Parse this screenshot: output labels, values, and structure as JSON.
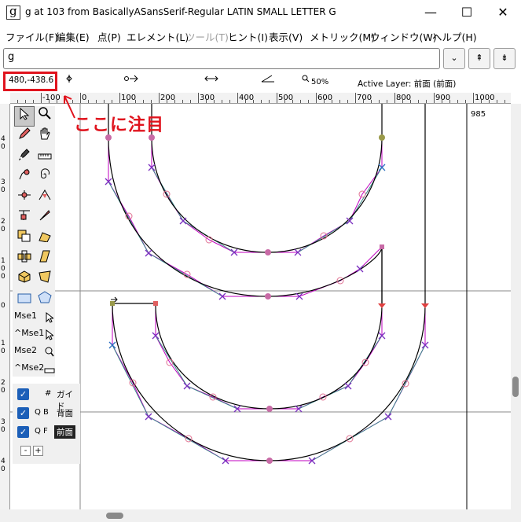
{
  "window": {
    "title": "g at 103 from BasicallyASansSerif-Regular LATIN SMALL LETTER G",
    "minimize": "—",
    "maximize": "☐",
    "close": "✕"
  },
  "menu": [
    {
      "label": "ファイル(F)",
      "enabled": true
    },
    {
      "label": "編集(E)",
      "enabled": true
    },
    {
      "label": "点(P)",
      "enabled": true
    },
    {
      "label": "エレメント(L)",
      "enabled": true
    },
    {
      "label": "ツール(T)",
      "enabled": false
    },
    {
      "label": "ヒント(I)",
      "enabled": true
    },
    {
      "label": "表示(V)",
      "enabled": true
    },
    {
      "label": "メトリック(M)",
      "enabled": true
    },
    {
      "label": "ウィンドウ(W)",
      "enabled": true
    },
    {
      "label": "ヘルプ(H)",
      "enabled": true
    }
  ],
  "glyph_field": {
    "value": "g"
  },
  "toolbar_buttons": {
    "dropdown": "⌄",
    "prev": "⇞",
    "next": "⇟"
  },
  "info": {
    "coordinates": "480,-438.6",
    "zoom": "50%",
    "active_layer": "Active Layer: 前面 (前面)"
  },
  "annotation": "ここに注目",
  "ruler": {
    "h_labels": [
      "-100",
      "0",
      "100",
      "200",
      "300",
      "400",
      "500",
      "600",
      "700",
      "800",
      "900",
      "1000"
    ],
    "advance_label": "985"
  },
  "tools": {
    "mouse_labels": [
      "Mse1",
      "^Mse1",
      "Mse2",
      "^Mse2"
    ]
  },
  "layers": [
    {
      "flag": "#",
      "name": "ガイド",
      "checked": true,
      "active": false
    },
    {
      "flag": "Q B",
      "name": "背面",
      "checked": true,
      "active": false
    },
    {
      "flag": "Q F",
      "name": "前面",
      "checked": true,
      "active": true
    }
  ],
  "layer_controls": {
    "remove": "-",
    "add": "+"
  },
  "colors": {
    "annotation": "#e0141e",
    "outline": "#000000",
    "handle_magenta": "#c000c0",
    "handle_blue": "#2a6fc0",
    "off_curve": "#7b2fbf",
    "on_curve": "#c86aa6",
    "interpolated": "#e07090",
    "teal_control": "#3a8a8a"
  }
}
